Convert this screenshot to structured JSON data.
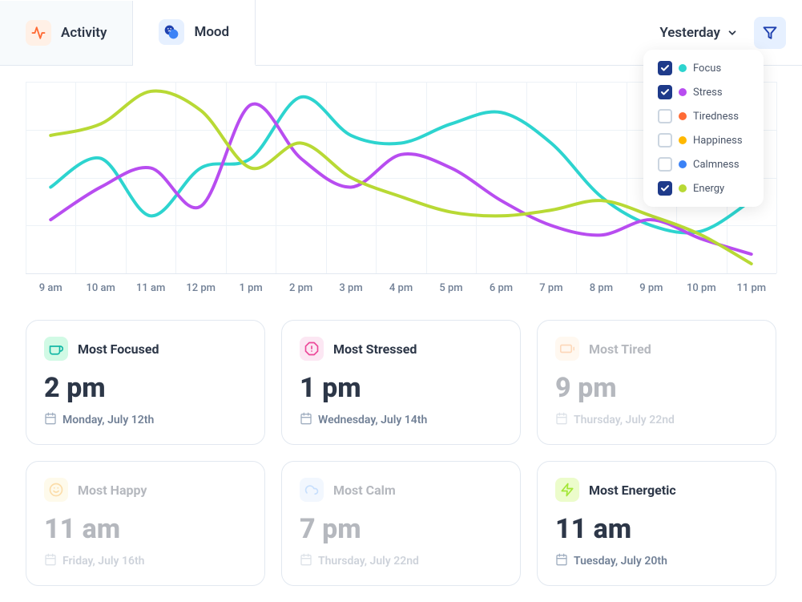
{
  "tabs": {
    "activity": "Activity",
    "mood": "Mood"
  },
  "dateSelector": "Yesterday",
  "legend": [
    {
      "label": "Focus",
      "color": "#2dd4cf",
      "checked": true
    },
    {
      "label": "Stress",
      "color": "#b84df0",
      "checked": true
    },
    {
      "label": "Tiredness",
      "color": "#ff6b35",
      "checked": false
    },
    {
      "label": "Happiness",
      "color": "#ffb800",
      "checked": false
    },
    {
      "label": "Calmness",
      "color": "#3b82f6",
      "checked": false
    },
    {
      "label": "Energy",
      "color": "#b8d935",
      "checked": true
    }
  ],
  "chart_data": {
    "type": "line",
    "categories": [
      "9 am",
      "10 am",
      "11 am",
      "12 pm",
      "1 pm",
      "2 pm",
      "3 pm",
      "4 pm",
      "5 pm",
      "6 pm",
      "7 pm",
      "8 pm",
      "9 pm",
      "10 pm",
      "11 pm"
    ],
    "ylim": [
      0,
      100
    ],
    "series": [
      {
        "name": "Focus",
        "color": "#2dd4cf",
        "values": [
          45,
          60,
          30,
          55,
          60,
          92,
          72,
          68,
          78,
          84,
          68,
          40,
          25,
          22,
          38
        ]
      },
      {
        "name": "Stress",
        "color": "#b84df0",
        "values": [
          28,
          45,
          55,
          35,
          88,
          60,
          45,
          62,
          55,
          38,
          25,
          20,
          28,
          18,
          10
        ]
      },
      {
        "name": "Energy",
        "color": "#b8d935",
        "values": [
          72,
          78,
          95,
          85,
          55,
          68,
          50,
          40,
          32,
          30,
          33,
          38,
          30,
          20,
          5
        ]
      }
    ]
  },
  "xLabels": [
    "9 am",
    "10 am",
    "11 am",
    "12 pm",
    "1 pm",
    "2 pm",
    "3 pm",
    "4 pm",
    "5 pm",
    "6 pm",
    "7 pm",
    "8 pm",
    "9 pm",
    "10 pm",
    "11 pm"
  ],
  "cards": [
    {
      "title": "Most Focused",
      "time": "2 pm",
      "date": "Monday, July 12th",
      "iconBg": "#d1fae5",
      "icon": "coffee",
      "iconColor": "#14b8a6",
      "active": true
    },
    {
      "title": "Most Stressed",
      "time": "1 pm",
      "date": "Wednesday, July 14th",
      "iconBg": "#fce7f3",
      "icon": "alert",
      "iconColor": "#ec4899",
      "active": true
    },
    {
      "title": "Most Tired",
      "time": "9 pm",
      "date": "Thursday, July 22nd",
      "iconBg": "#ffedd5",
      "icon": "battery",
      "iconColor": "#fb923c",
      "active": false
    },
    {
      "title": "Most Happy",
      "time": "11 am",
      "date": "Friday, July 16th",
      "iconBg": "#fef3c7",
      "icon": "smile",
      "iconColor": "#f59e0b",
      "active": false
    },
    {
      "title": "Most Calm",
      "time": "7 pm",
      "date": "Thursday, July 22nd",
      "iconBg": "#dbeafe",
      "icon": "cloud",
      "iconColor": "#60a5fa",
      "active": false
    },
    {
      "title": "Most Energetic",
      "time": "11 am",
      "date": "Tuesday, July 20th",
      "iconBg": "#ecfccb",
      "icon": "bolt",
      "iconColor": "#a3e635",
      "active": true
    }
  ]
}
